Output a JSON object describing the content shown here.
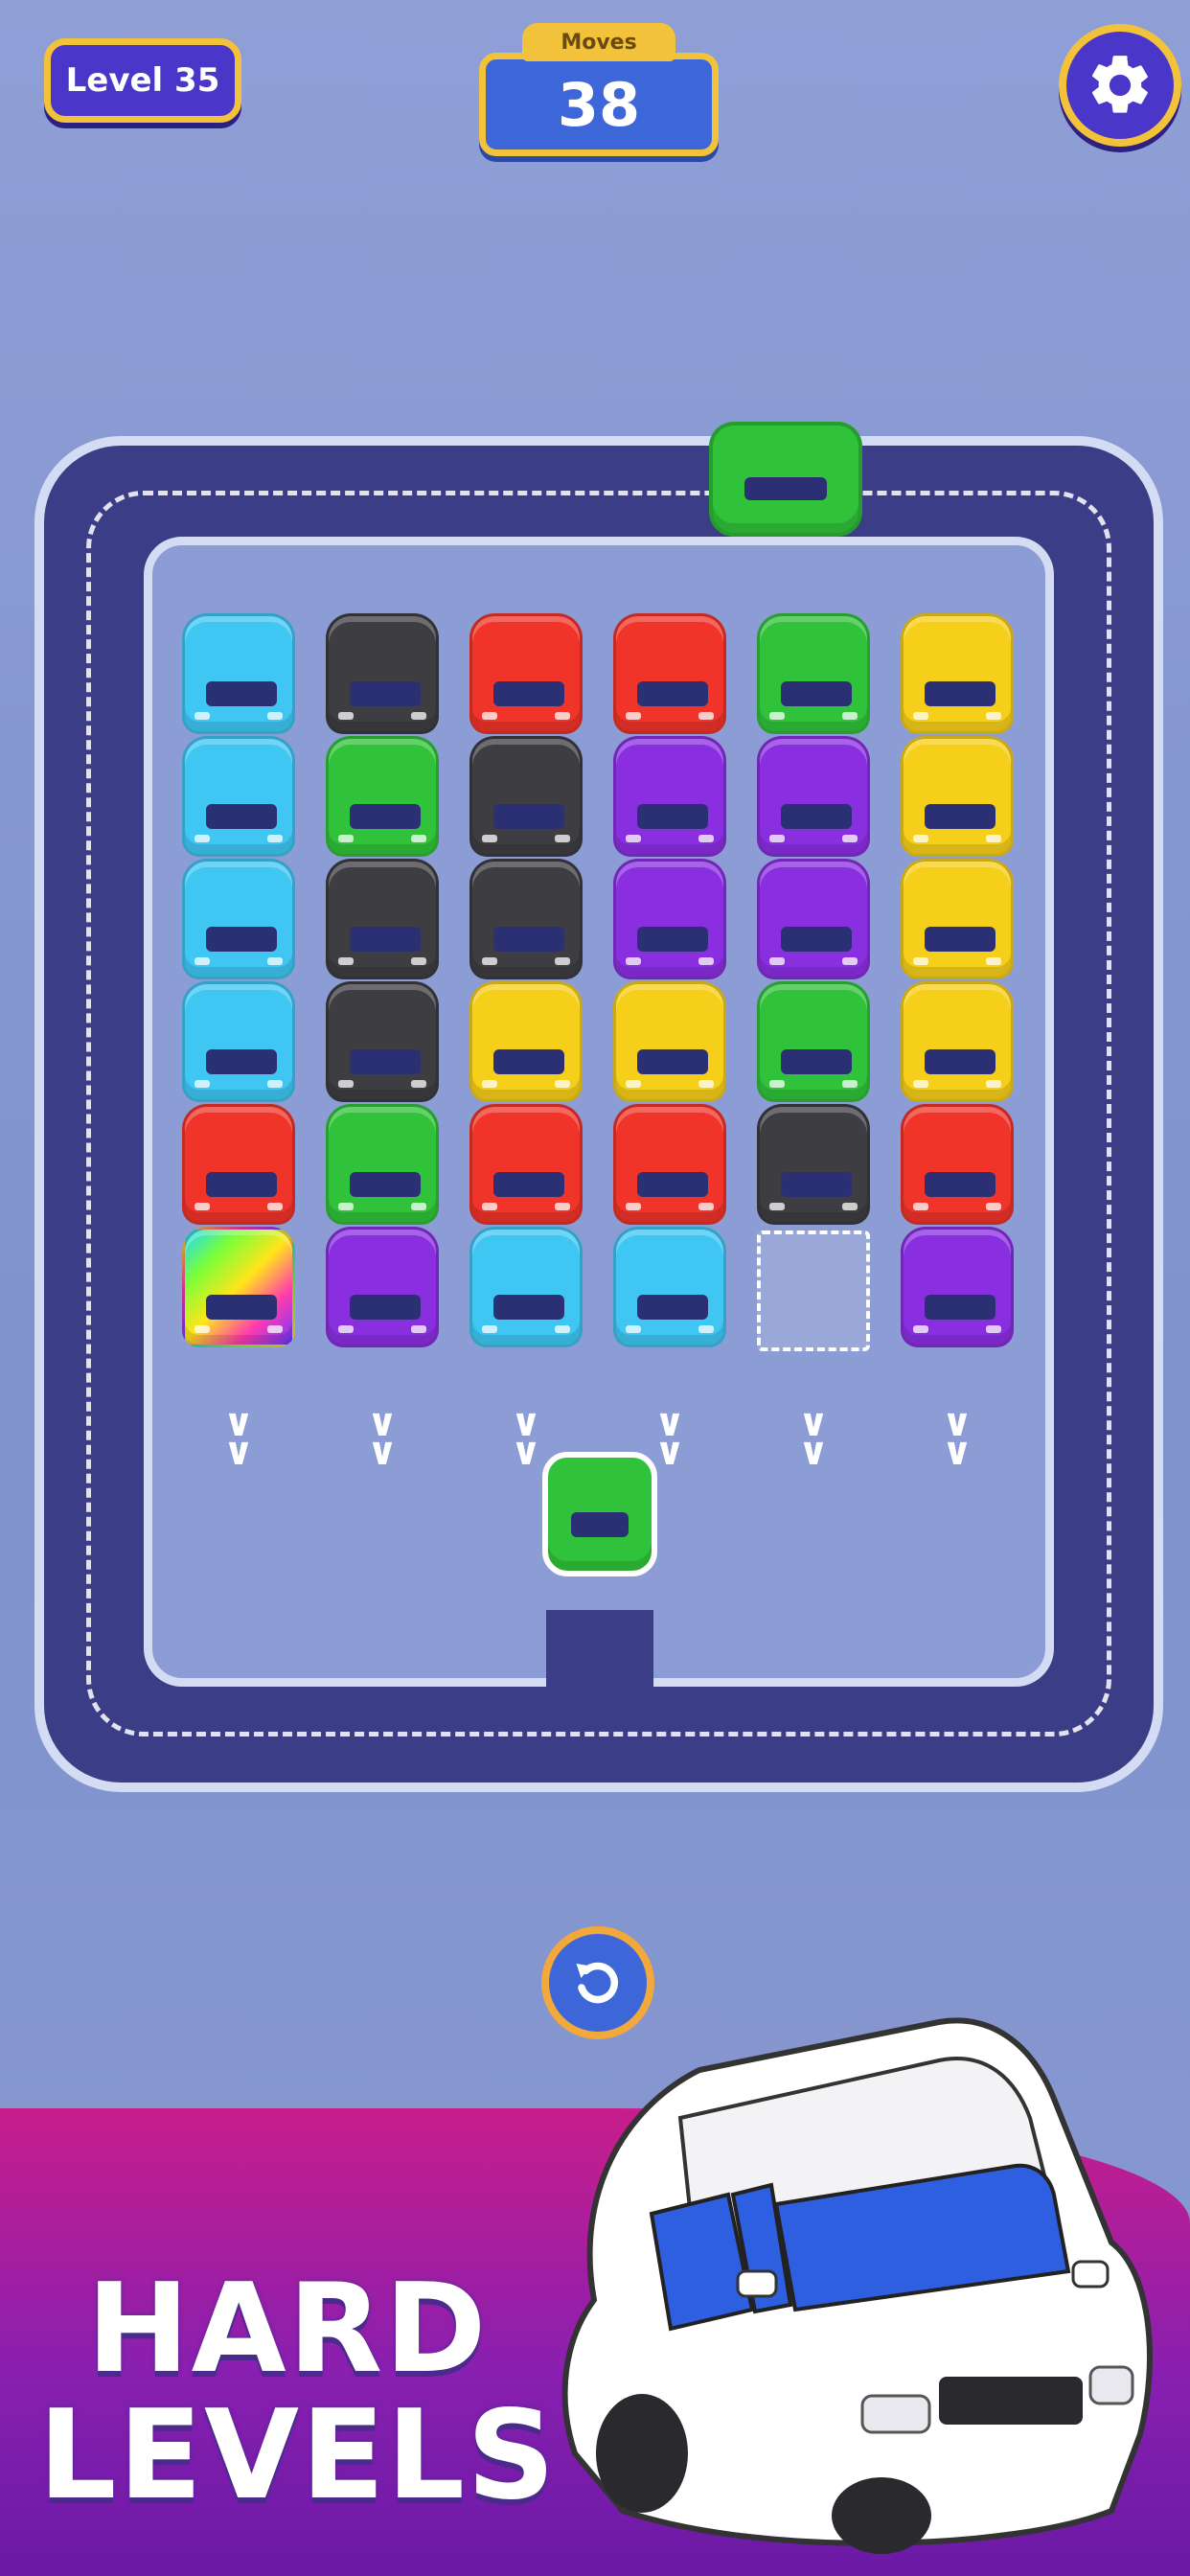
{
  "hud": {
    "level_label": "Level 35",
    "moves_label": "Moves",
    "moves_count": "38"
  },
  "icons": {
    "settings": "gear-icon",
    "undo": "undo-icon",
    "chevron": "chevron-down-icon"
  },
  "colors": {
    "cyan": "#3fc6f2",
    "black": "#3d3d42",
    "red": "#f0342a",
    "purple": "#8a2fe0",
    "green": "#30c23a",
    "yellow": "#f6cf1a",
    "accent_gold": "#f2c23a",
    "hud_blue": "#4a36c8"
  },
  "grid": {
    "columns": [
      [
        "cyan",
        "cyan",
        "cyan",
        "cyan",
        "red",
        "rainbow"
      ],
      [
        "black",
        "green",
        "black",
        "black",
        "green",
        "purple"
      ],
      [
        "red",
        "black",
        "black",
        "yellow",
        "red",
        "cyan"
      ],
      [
        "red",
        "purple",
        "purple",
        "yellow",
        "red",
        "cyan"
      ],
      [
        "green",
        "purple",
        "purple",
        "green",
        "black",
        "empty"
      ],
      [
        "yellow",
        "yellow",
        "yellow",
        "yellow",
        "red",
        "purple"
      ]
    ]
  },
  "moving_cars": [
    "green",
    "green"
  ],
  "promo": {
    "line1": "HARD",
    "line2": "LEVELS"
  }
}
